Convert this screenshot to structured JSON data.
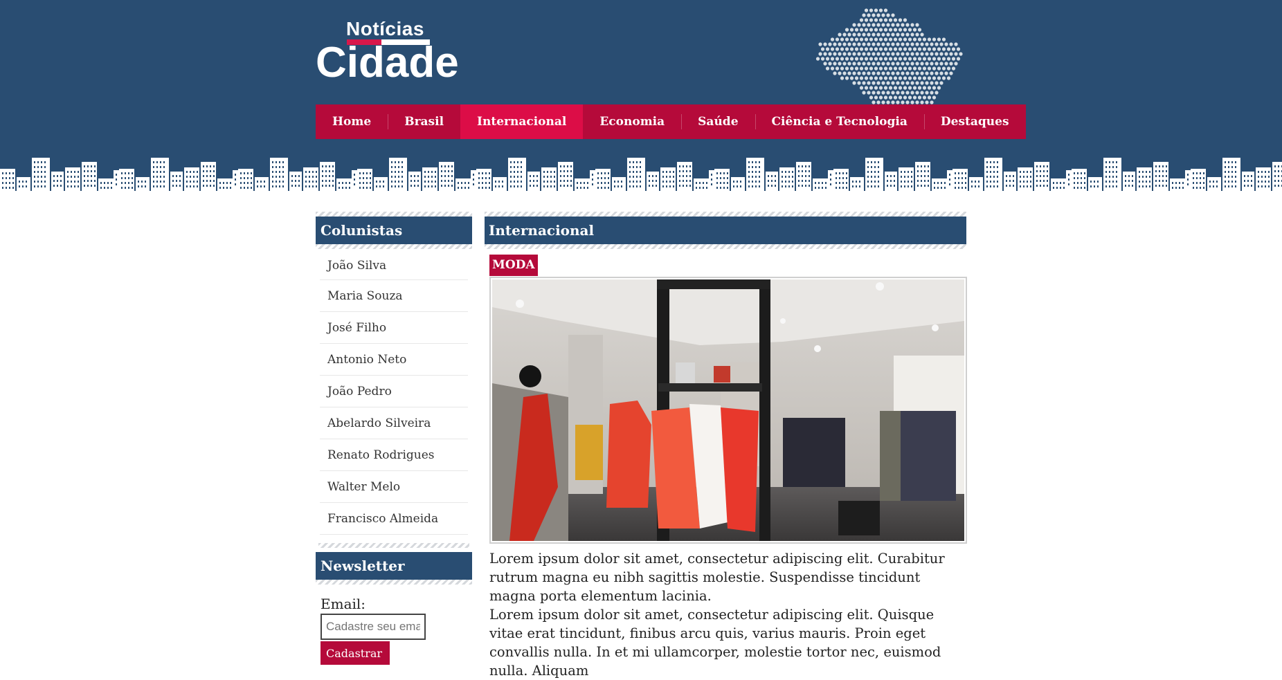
{
  "header": {
    "logo_small": "Notícias",
    "logo_big": "Cidade",
    "colors": {
      "background": "#294d72",
      "accent": "#b50a3a",
      "accent_active": "#dc0d47"
    }
  },
  "nav": {
    "items": [
      {
        "label": "Home",
        "active": false
      },
      {
        "label": "Brasil",
        "active": false
      },
      {
        "label": "Internacional",
        "active": true
      },
      {
        "label": "Economia",
        "active": false
      },
      {
        "label": "Saúde",
        "active": false
      },
      {
        "label": "Ciência e Tecnologia",
        "active": false
      },
      {
        "label": "Destaques",
        "active": false
      }
    ]
  },
  "sidebar": {
    "columnists": {
      "title": "Colunistas",
      "items": [
        "João Silva",
        "Maria Souza",
        "José Filho",
        "Antonio Neto",
        "João Pedro",
        "Abelardo Silveira",
        "Renato Rodrigues",
        "Walter Melo",
        "Francisco Almeida"
      ]
    },
    "newsletter": {
      "title": "Newsletter",
      "email_label": "Email:",
      "email_placeholder": "Cadastre seu email",
      "submit_label": "Cadastrar"
    }
  },
  "main": {
    "title": "Internacional",
    "tag": "MODA",
    "image_alt_icon": "clothing-store-photo",
    "paragraphs": [
      "Lorem ipsum dolor sit amet, consectetur adipiscing elit. Curabitur rutrum magna eu nibh sagittis molestie. Suspendisse tincidunt magna porta elementum lacinia.",
      "Lorem ipsum dolor sit amet, consectetur adipiscing elit. Quisque vitae erat tincidunt, finibus arcu quis, varius mauris. Proin eget convallis nulla. In et mi ullamcorper, molestie tortor nec, euismod nulla. Aliquam"
    ]
  }
}
